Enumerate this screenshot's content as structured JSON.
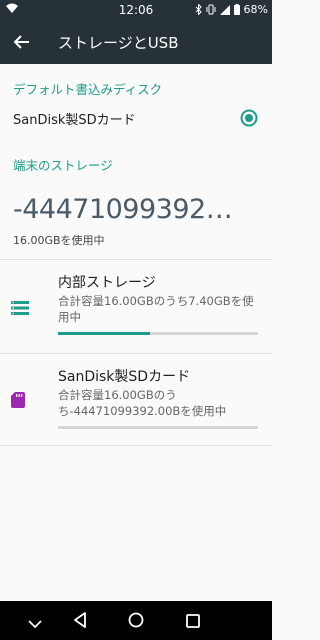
{
  "status_bar": {
    "time": "12:06",
    "battery": "68%",
    "icons": [
      "wifi-icon",
      "bluetooth-icon",
      "vibrate-icon",
      "signal-icon",
      "battery-icon"
    ]
  },
  "app_bar": {
    "title": "ストレージとUSB",
    "back_icon": "arrow-back-icon"
  },
  "default_write_disk": {
    "header": "デフォルト書込みディスク",
    "option_label": "SanDisk製SDカード",
    "selected": true
  },
  "device_storage": {
    "header": "端末のストレージ",
    "used_value": "-44471099392…",
    "total_text": "16.00GBを使用中"
  },
  "storage_items": [
    {
      "name": "内部ストレージ",
      "description": "合計容量16.00GBのうち7.40GBを使用中",
      "progress": 0.46,
      "icon": "storage-icon"
    },
    {
      "name": "SanDisk製SDカード",
      "description": "合計容量16.00GBのうち-44471099392.00Bを使用中",
      "progress": 0.0,
      "icon": "sd-card-icon"
    }
  ],
  "colors": {
    "accent": "#1e9c8a",
    "app_bar": "#263238",
    "sd_icon": "#9c27b0"
  }
}
